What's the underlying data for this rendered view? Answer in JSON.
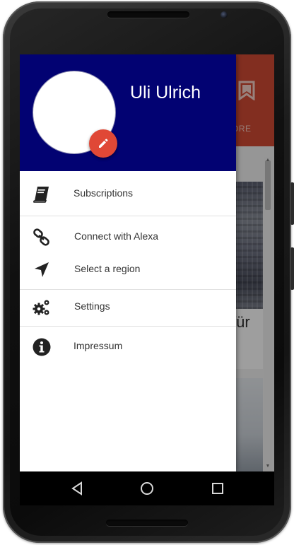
{
  "drawer": {
    "user_name": "Uli Ulrich",
    "header_color": "#020272",
    "fab_color": "#e04836",
    "items": [
      {
        "label": "Subscriptions",
        "icon": "book-icon"
      },
      {
        "label": "Connect with Alexa",
        "icon": "link-icon"
      },
      {
        "label": "Select a region",
        "icon": "navigation-arrow-icon"
      },
      {
        "label": "Settings",
        "icon": "gears-icon"
      },
      {
        "label": "Impressum",
        "icon": "info-icon"
      }
    ]
  },
  "background_app": {
    "app_bar_color": "#d24b35",
    "more_label": "ORE",
    "article_word": "für"
  },
  "navbar": {
    "buttons": [
      "back-icon",
      "home-icon",
      "recents-icon"
    ]
  }
}
